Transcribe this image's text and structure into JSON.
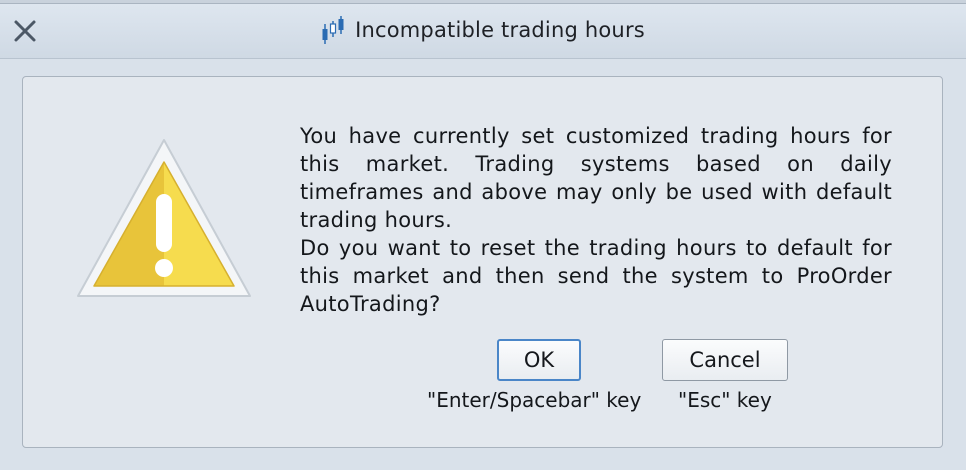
{
  "window": {
    "title": "Incompatible trading hours",
    "icons": {
      "close": "close-icon",
      "app": "candlestick-chart-icon",
      "warning": "warning-icon"
    }
  },
  "dialog": {
    "message_paragraph_1": "You have currently set customized trading hours for this market. Trading systems based on daily timeframes and above may only be used with default trading hours.",
    "message_paragraph_2": "Do you want to reset the trading hours to default for this market and then send the system to ProOrder AutoTrading?"
  },
  "buttons": {
    "ok_label": "OK",
    "ok_hint": "\"Enter/Spacebar\" key",
    "cancel_label": "Cancel",
    "cancel_hint": "\"Esc\" key"
  },
  "colors": {
    "titlebar": "#d6dfe8",
    "panel": "#e3e8ee",
    "focus_border": "#4a86c8",
    "warning_fill": "#f1cf3b"
  }
}
